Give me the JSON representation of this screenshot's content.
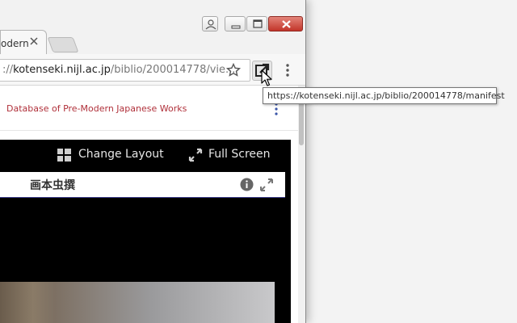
{
  "window": {
    "controls": {
      "user_icon": "user-icon",
      "minimize_icon": "minimize-icon",
      "maximize_icon": "maximize-icon",
      "close_icon": "close-icon"
    }
  },
  "tabs": [
    {
      "title": "odern",
      "active": true
    }
  ],
  "toolbar": {
    "url_prefix": "://",
    "url_host": "kotenseki.nijl.ac.jp",
    "url_path": "/biblio/200014778/vie...",
    "star_icon": "star-icon",
    "extension_icon": "open-external-icon",
    "menu_icon": "more-vert-icon"
  },
  "tooltip": {
    "text": "https://kotenseki.nijl.ac.jp/biblio/200014778/manifest"
  },
  "page": {
    "site_title": "Database of Pre-Modern Japanese Works",
    "viewer": {
      "change_layout_label": "Change Layout",
      "full_screen_label": "Full Screen",
      "panel_title": "画本虫撰"
    }
  },
  "colors": {
    "site_title": "#b0303a",
    "close_button": "#c2352a",
    "viewer_bg": "#000000"
  }
}
